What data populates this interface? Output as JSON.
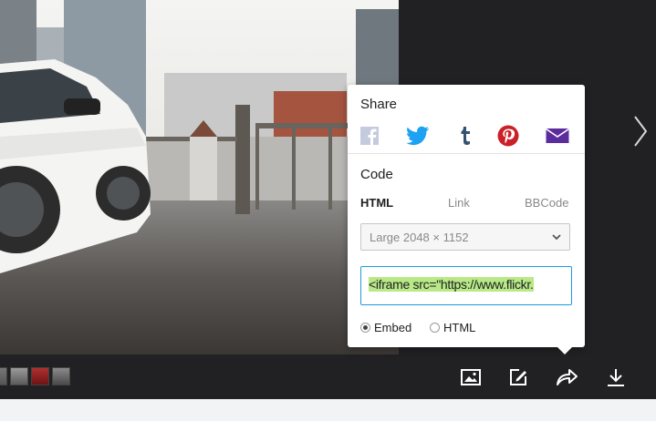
{
  "share_panel": {
    "share_title": "Share",
    "social": [
      "facebook-icon",
      "twitter-icon",
      "tumblr-icon",
      "pinterest-icon",
      "email-icon"
    ],
    "code_title": "Code",
    "tabs": [
      {
        "label": "HTML",
        "active": true
      },
      {
        "label": "Link",
        "active": false
      },
      {
        "label": "BBCode",
        "active": false
      }
    ],
    "size_select_value": "Large 2048 × 1152",
    "embed_code": "<iframe src=\"https://www.flickr.",
    "embed_options": [
      {
        "label": "Embed",
        "selected": true
      },
      {
        "label": "HTML",
        "selected": false
      }
    ]
  },
  "colors": {
    "facebook": "#c3cbdc",
    "twitter": "#1da1f2",
    "tumblr": "#34526f",
    "pinterest": "#cb2027",
    "email": "#5b2c9e",
    "selection": "#b8e986",
    "focus": "#1c9be6"
  },
  "toolbar": [
    "image-icon",
    "edit-icon",
    "share-icon",
    "download-icon"
  ]
}
